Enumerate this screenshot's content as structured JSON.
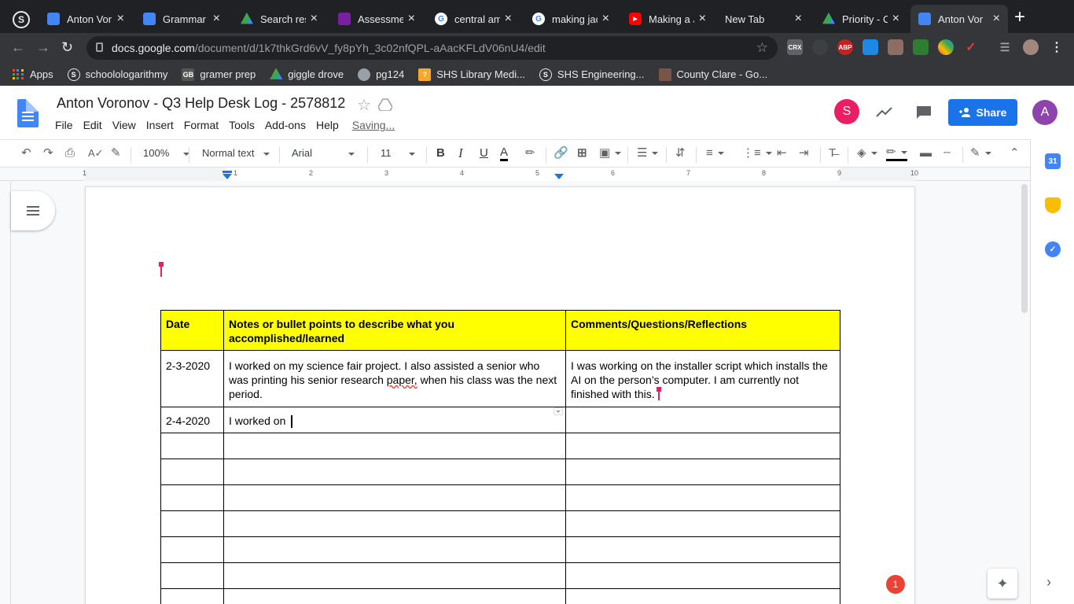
{
  "browser": {
    "tabs": [
      {
        "title": "Anton Vor",
        "color": "#4285f4",
        "icon": "docs-icon"
      },
      {
        "title": "Grammar P",
        "color": "#4285f4",
        "icon": "docs-icon"
      },
      {
        "title": "Search res",
        "color": "#fbbc04",
        "icon": "drive-icon"
      },
      {
        "title": "Assessme",
        "color": "#7b1fa2",
        "icon": "forms-icon"
      },
      {
        "title": "central am",
        "color": "#ffffff",
        "icon": "google-icon"
      },
      {
        "title": "making jac",
        "color": "#ffffff",
        "icon": "google-icon"
      },
      {
        "title": "Making a J",
        "color": "#ff0000",
        "icon": "youtube-icon"
      },
      {
        "title": "New Tab",
        "color": "",
        "icon": ""
      },
      {
        "title": "Priority - C",
        "color": "#fbbc04",
        "icon": "drive-icon"
      },
      {
        "title": "Anton Vor",
        "color": "#4285f4",
        "icon": "docs-icon",
        "active": true
      }
    ],
    "url_host": "docs.google.com",
    "url_path": "/document/d/1k7thkGrd6vV_fy8pYh_3c02nfQPL-aAacKFLdV06nU4/edit",
    "bookmarks": [
      "Apps",
      "schoolologarithmy",
      "gramer prep",
      "giggle drove",
      "pg124",
      "SHS Library Medi...",
      "SHS Engineering...",
      "County Clare - Go..."
    ],
    "extensions": [
      "CRX",
      "ABP"
    ]
  },
  "docs": {
    "title": "Anton Voronov - Q3 Help Desk Log - 2578812",
    "menus": [
      "File",
      "Edit",
      "View",
      "Insert",
      "Format",
      "Tools",
      "Add-ons",
      "Help"
    ],
    "saving": "Saving...",
    "share_label": "Share",
    "collaborator_initial": "S",
    "user_initial": "A",
    "toolbar": {
      "zoom": "100%",
      "style": "Normal text",
      "font": "Arial",
      "size": "11"
    },
    "ruler_numbers": [
      "1",
      "1",
      "2",
      "3",
      "4",
      "5",
      "6",
      "7",
      "8",
      "9",
      "10"
    ],
    "notification_count": "1"
  },
  "table": {
    "headers": [
      "Date",
      "Notes or bullet points to describe what you accomplished/learned",
      "Comments/Questions/Reflections"
    ],
    "rows": [
      {
        "date": "2-3-2020",
        "notes_before": "I worked on my science fair project. I also assisted a senior who was printing his senior research ",
        "notes_spell": "paper,",
        "notes_after": " when his class was the next period.",
        "comments": "I was working on the installer script which installs the AI on the person’s computer. I am currently not finished with this."
      },
      {
        "date": "2-4-2020",
        "notes": "I worked on ",
        "comments": ""
      }
    ],
    "empty_rows": 7
  },
  "colors": {
    "header_fill": "#ffff00",
    "share_blue": "#1a73e8",
    "collab_pink": "#e91e63",
    "chrome_dark": "#202124"
  }
}
